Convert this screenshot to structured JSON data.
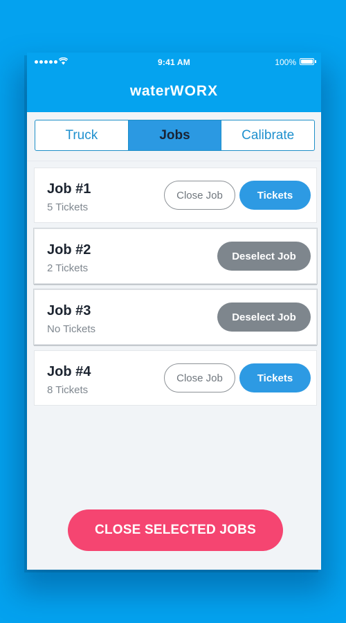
{
  "status_bar": {
    "time": "9:41 AM",
    "battery": "100%"
  },
  "header": {
    "logo_lower": "water",
    "logo_upper": "WORX"
  },
  "tabs": [
    {
      "label": "Truck",
      "active": false
    },
    {
      "label": "Jobs",
      "active": true
    },
    {
      "label": "Calibrate",
      "active": false
    }
  ],
  "jobs": [
    {
      "title": "Job #1",
      "subtitle": "5 Tickets",
      "close_label": "Close Job",
      "tickets_label": "Tickets"
    },
    {
      "title": "Job #2",
      "subtitle": "2 Tickets",
      "deselect_label": "Deselect Job"
    },
    {
      "title": "Job #3",
      "subtitle": "No Tickets",
      "deselect_label": "Deselect Job"
    },
    {
      "title": "Job #4",
      "subtitle": "8 Tickets",
      "close_label": "Close Job",
      "tickets_label": "Tickets"
    }
  ],
  "footer": {
    "cta_label": "CLOSE SELECTED JOBS"
  },
  "colors": {
    "background": "#04a2ef",
    "header": "#05a3ef",
    "primary_button": "#2d9ae3",
    "deselect_button": "#7e868d",
    "cta": "#f54571"
  }
}
